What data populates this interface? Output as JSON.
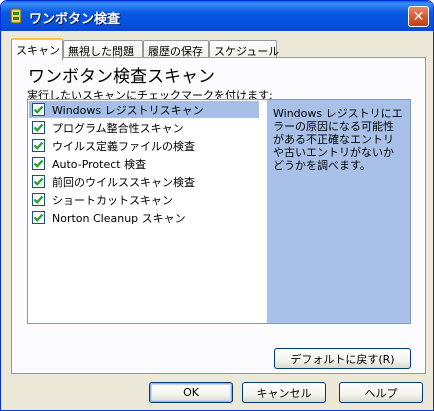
{
  "window": {
    "title": "ワンボタン検査",
    "close_label": "✕",
    "icon": "norton-icon"
  },
  "tabs": [
    {
      "label": "スキャン",
      "active": true
    },
    {
      "label": "無視した問題",
      "active": false
    },
    {
      "label": "履歴の保存",
      "active": false
    },
    {
      "label": "スケジュール",
      "active": false
    }
  ],
  "panel": {
    "heading": "ワンボタン検査スキャン",
    "instruction": "実行したいスキャンにチェックマークを付けます:",
    "items": [
      {
        "label": "Windows レジストリスキャン",
        "checked": true,
        "selected": true
      },
      {
        "label": "プログラム整合性スキャン",
        "checked": true,
        "selected": false
      },
      {
        "label": "ウイルス定義ファイルの検査",
        "checked": true,
        "selected": false
      },
      {
        "label": "Auto-Protect 検査",
        "checked": true,
        "selected": false
      },
      {
        "label": "前回のウイルススキャン検査",
        "checked": true,
        "selected": false
      },
      {
        "label": "ショートカットスキャン",
        "checked": true,
        "selected": false
      },
      {
        "label": "Norton Cleanup スキャン",
        "checked": true,
        "selected": false
      }
    ],
    "description": "Windows レジストリにエラーの原因になる可能性がある不正確なエントリや古いエントリがないかどうかを調べます。",
    "default_button": "デフォルトに戻す(R)"
  },
  "footer": {
    "ok": "OK",
    "cancel": "キャンセル",
    "help": "ヘルプ"
  },
  "colors": {
    "titlebar": "#0758e3",
    "selection": "#a6bfe6",
    "description_bg": "#a9c1e8",
    "check": "#21a121"
  }
}
